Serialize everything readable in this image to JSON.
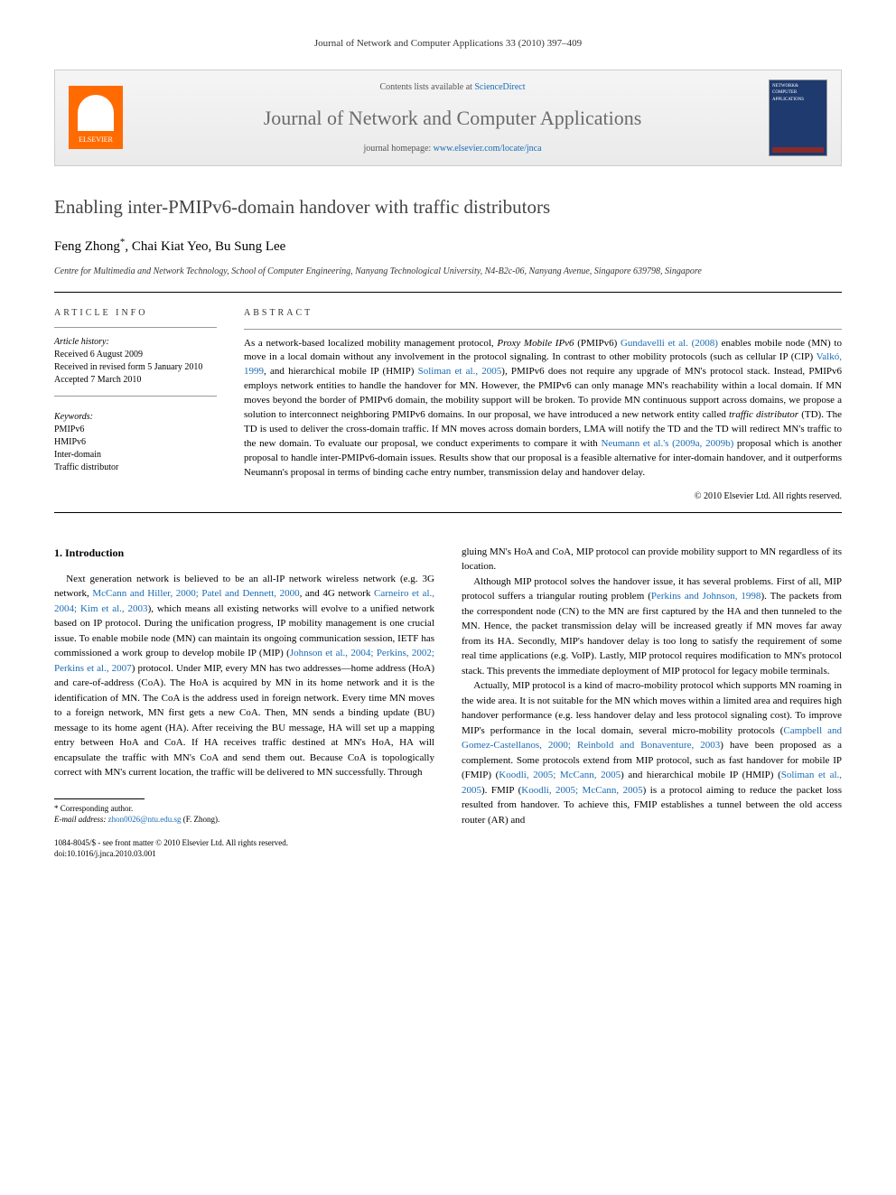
{
  "running_header": "Journal of Network and Computer Applications 33 (2010) 397–409",
  "banner": {
    "elsevier": "ELSEVIER",
    "contents_prefix": "Contents lists available at ",
    "contents_link": "ScienceDirect",
    "journal_title": "Journal of Network and Computer Applications",
    "homepage_prefix": "journal homepage: ",
    "homepage_url": "www.elsevier.com/locate/jnca",
    "cover_text": "NETWORK& COMPUTER APPLICATIONS"
  },
  "article": {
    "title": "Enabling inter-PMIPv6-domain handover with traffic distributors",
    "authors": "Feng Zhong",
    "corr_marker": "*",
    "authors_rest": ", Chai Kiat Yeo, Bu Sung Lee",
    "affiliation": "Centre for Multimedia and Network Technology, School of Computer Engineering, Nanyang Technological University, N4-B2c-06, Nanyang Avenue, Singapore 639798, Singapore"
  },
  "info": {
    "heading": "ARTICLE INFO",
    "history_head": "Article history:",
    "received": "Received 6 August 2009",
    "revised": "Received in revised form 5 January 2010",
    "accepted": "Accepted 7 March 2010",
    "keywords_head": "Keywords:",
    "kw1": "PMIPv6",
    "kw2": "HMIPv6",
    "kw3": "Inter-domain",
    "kw4": "Traffic distributor"
  },
  "abstract": {
    "heading": "ABSTRACT",
    "text_1": "As a network-based localized mobility management protocol, ",
    "italic_1": "Proxy Mobile IPv6",
    "text_2": " (PMIPv6) ",
    "link_1": "Gundavelli et al. (2008)",
    "text_3": " enables mobile node (MN) to move in a local domain without any involvement in the protocol signaling. In contrast to other mobility protocols (such as cellular IP (CIP) ",
    "link_2": "Valkó, 1999",
    "text_4": ", and hierarchical mobile IP (HMIP) ",
    "link_3": "Soliman et al., 2005",
    "text_5": "), PMIPv6 does not require any upgrade of MN's protocol stack. Instead, PMIPv6 employs network entities to handle the handover for MN. However, the PMIPv6 can only manage MN's reachability within a local domain. If MN moves beyond the border of PMIPv6 domain, the mobility support will be broken. To provide MN continuous support across domains, we propose a solution to interconnect neighboring PMIPv6 domains. In our proposal, we have introduced a new network entity called ",
    "italic_2": "traffic distributor",
    "text_6": " (TD). The TD is used to deliver the cross-domain traffic. If MN moves across domain borders, LMA will notify the TD and the TD will redirect MN's traffic to the new domain. To evaluate our proposal, we conduct experiments to compare it with ",
    "link_4": "Neumann et al.'s (2009a, 2009b)",
    "text_7": " proposal which is another proposal to handle inter-PMIPv6-domain issues. Results show that our proposal is a feasible alternative for inter-domain handover, and it outperforms Neumann's proposal in terms of binding cache entry number, transmission delay and handover delay.",
    "copyright": "© 2010 Elsevier Ltd. All rights reserved."
  },
  "body": {
    "section1_heading": "1. Introduction",
    "col1_p1a": "Next generation network is believed to be an all-IP network wireless network (e.g. 3G network, ",
    "col1_link1": "McCann and Hiller, 2000; Patel and Dennett, 2000",
    "col1_p1b": ", and 4G network ",
    "col1_link2": "Carneiro et al., 2004; Kim et al., 2003",
    "col1_p1c": "), which means all existing networks will evolve to a unified network based on IP protocol. During the unification progress, IP mobility management is one crucial issue. To enable mobile node (MN) can maintain its ongoing communication session, IETF has commissioned a work group to develop mobile IP (MIP) (",
    "col1_link3": "Johnson et al., 2004; Perkins, 2002; Perkins et al., 2007",
    "col1_p1d": ") protocol. Under MIP, every MN has two addresses—home address (HoA) and care-of-address (CoA). The HoA is acquired by MN in its home network and it is the identification of MN. The CoA is the address used in foreign network. Every time MN moves to a foreign network, MN first gets a new CoA. Then, MN sends a binding update (BU) message to its home agent (HA). After receiving the BU message, HA will set up a mapping entry between HoA and CoA. If HA receives traffic destined at MN's HoA, HA will encapsulate the traffic with MN's CoA and send them out. Because CoA is topologically correct with MN's current location, the traffic will be delivered to MN successfully. Through",
    "col2_p1": "gluing MN's HoA and CoA, MIP protocol can provide mobility support to MN regardless of its location.",
    "col2_p2a": "Although MIP protocol solves the handover issue, it has several problems. First of all, MIP protocol suffers a triangular routing problem (",
    "col2_link1": "Perkins and Johnson, 1998",
    "col2_p2b": "). The packets from the correspondent node (CN) to the MN are first captured by the HA and then tunneled to the MN. Hence, the packet transmission delay will be increased greatly if MN moves far away from its HA. Secondly, MIP's handover delay is too long to satisfy the requirement of some real time applications (e.g. VoIP). Lastly, MIP protocol requires modification to MN's protocol stack. This prevents the immediate deployment of MIP protocol for legacy mobile terminals.",
    "col2_p3a": "Actually, MIP protocol is a kind of macro-mobility protocol which supports MN roaming in the wide area. It is not suitable for the MN which moves within a limited area and requires high handover performance (e.g. less handover delay and less protocol signaling cost). To improve MIP's performance in the local domain, several micro-mobility protocols (",
    "col2_link2": "Campbell and Gomez-Castellanos, 2000; Reinbold and Bonaventure, 2003",
    "col2_p3b": ") have been proposed as a complement. Some protocols extend from MIP protocol, such as fast handover for mobile IP (FMIP) (",
    "col2_link3": "Koodli, 2005; McCann, 2005",
    "col2_p3c": ") and hierarchical mobile IP (HMIP) (",
    "col2_link4": "Soliman et al., 2005",
    "col2_p3d": "). FMIP (",
    "col2_link5": "Koodli, 2005; McCann, 2005",
    "col2_p3e": ") is a protocol aiming to reduce the packet loss resulted from handover. To achieve this, FMIP establishes a tunnel between the old access router (AR) and"
  },
  "footnote": {
    "corr": "* Corresponding author.",
    "email_label": "E-mail address: ",
    "email": "zhon0026@ntu.edu.sg",
    "email_name": " (F. Zhong)."
  },
  "footer": {
    "issn": "1084-8045/$ - see front matter © 2010 Elsevier Ltd. All rights reserved.",
    "doi": "doi:10.1016/j.jnca.2010.03.001"
  }
}
